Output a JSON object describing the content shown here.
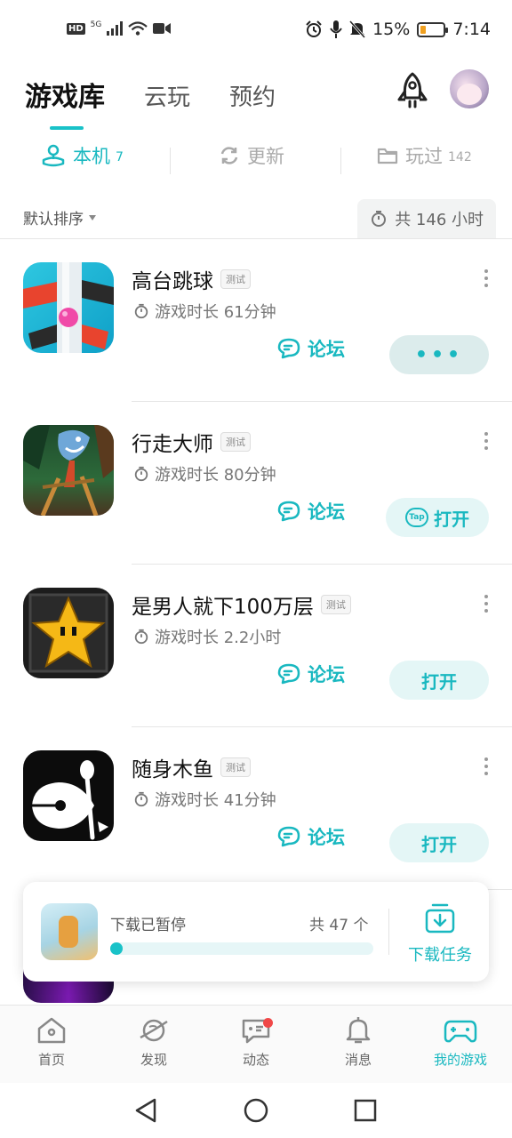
{
  "status_bar": {
    "hd": "HD",
    "net": "5G",
    "battery": "15%",
    "time": "7:14",
    "battery_level": 0.15
  },
  "header": {
    "tabs": [
      {
        "label": "游戏库"
      },
      {
        "label": "云玩"
      },
      {
        "label": "预约"
      }
    ]
  },
  "sub_tabs": [
    {
      "label": "本机",
      "count": "7"
    },
    {
      "label": "更新",
      "count": ""
    },
    {
      "label": "玩过",
      "count": "142"
    }
  ],
  "sort": {
    "label": "默认排序"
  },
  "total_time": "共 146 小时",
  "games": [
    {
      "name": "高台跳球",
      "badge": "测试",
      "time": "游戏时长 61分钟",
      "forum": "论坛",
      "action": "•••"
    },
    {
      "name": "行走大师",
      "badge": "测试",
      "time": "游戏时长 80分钟",
      "forum": "论坛",
      "action": "打开",
      "tap": "Tap"
    },
    {
      "name": "是男人就下100万层",
      "badge": "测试",
      "time": "游戏时长 2.2小时",
      "forum": "论坛",
      "action": "打开"
    },
    {
      "name": "随身木鱼",
      "badge": "测试",
      "time": "游戏时长 41分钟",
      "forum": "论坛",
      "action": "打开"
    }
  ],
  "download": {
    "status": "下载已暂停",
    "count": "共 47 个",
    "task_label": "下载任务",
    "progress": 0.03
  },
  "bottom_nav": [
    {
      "label": "首页"
    },
    {
      "label": "发现"
    },
    {
      "label": "动态"
    },
    {
      "label": "消息"
    },
    {
      "label": "我的游戏"
    }
  ],
  "colors": {
    "accent": "#19c2c8",
    "text": "#222222",
    "muted": "#888888"
  }
}
